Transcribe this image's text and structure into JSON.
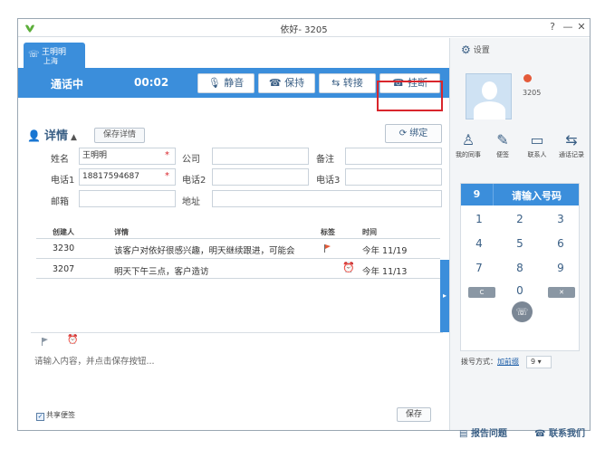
{
  "window": {
    "title": "依好- 3205",
    "help_glyph": "?",
    "min_glyph": "—",
    "close_glyph": "✕"
  },
  "call_tab": {
    "name": "王明明",
    "city": "上海"
  },
  "callbar": {
    "status": "通话中",
    "timer": "00:02",
    "mute_label": "静音",
    "hold_label": "保持",
    "transfer_label": "转接",
    "hangup_label": "挂断"
  },
  "details": {
    "title": "详情",
    "save_details_label": "保存详情",
    "bind_label": "绑定",
    "name_label": "姓名",
    "name_value": "王明明",
    "company_label": "公司",
    "remark_label": "备注",
    "phone1_label": "电话1",
    "phone1_value": "18817594687",
    "phone2_label": "电话2",
    "phone3_label": "电话3",
    "email_label": "邮箱",
    "address_label": "地址",
    "required_mark": "*"
  },
  "notes_table": {
    "headers": [
      "创建人",
      "详情",
      "标签",
      "时间"
    ],
    "rows": [
      {
        "creator": "3230",
        "detail": "该客户对依好很感兴趣，明天继续跟进，可能会",
        "time": "今年 11/19",
        "tag": "flag"
      },
      {
        "creator": "3207",
        "detail": "明天下午三点，客户造访",
        "time": "今年 11/13",
        "tag": "alarm"
      }
    ]
  },
  "note_editor": {
    "placeholder": "请输入内容，并点击保存按钮...",
    "share_label": "共享便签",
    "share_checked": true,
    "save_label": "保存"
  },
  "right_panel": {
    "settings_label": "设置",
    "extension": "3205",
    "quick_items": [
      "我的同事",
      "便签",
      "联系人",
      "通话记录"
    ],
    "dialer": {
      "selected_digit": "9",
      "placeholder": "请输入号码",
      "keys": [
        "1",
        "2",
        "3",
        "4",
        "5",
        "6",
        "7",
        "8",
        "9",
        "C",
        "0",
        "✕"
      ]
    },
    "dial_mode_label": "拨号方式：",
    "dial_mode_value": "加前缀",
    "dial_prefix": "9",
    "report_label": "报告问题",
    "contact_label": "联系我们"
  },
  "colors": {
    "accent": "#3b8edb",
    "highlight_frame": "#d9262c",
    "flag": "#e45b3a",
    "alarm": "#2f9e44"
  }
}
